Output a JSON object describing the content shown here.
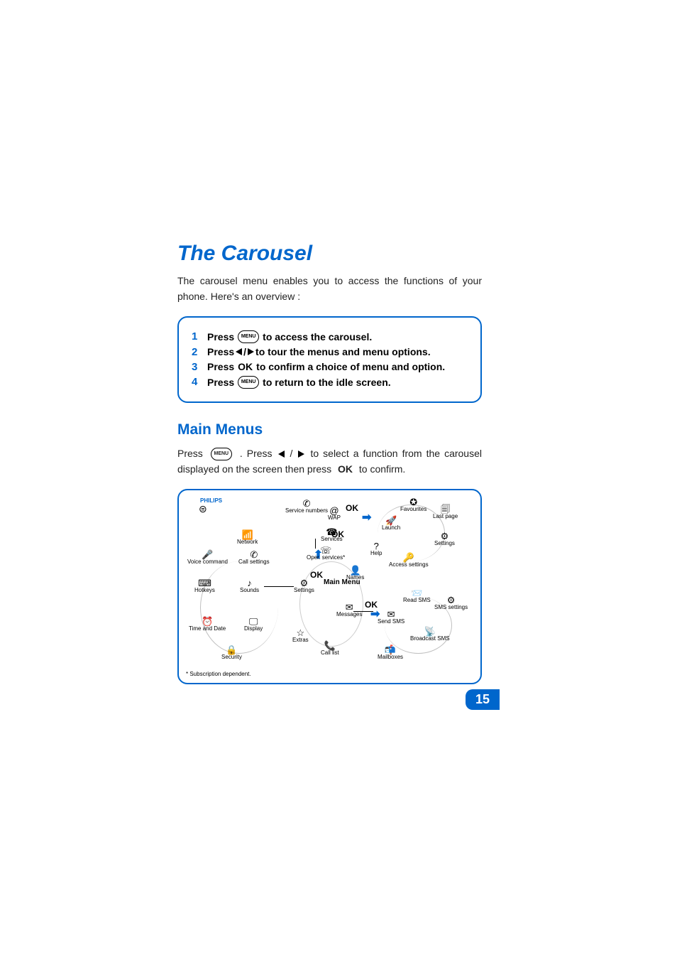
{
  "title": "The Carousel",
  "intro": "The carousel menu enables you to access the functions of your phone. Here's an overview :",
  "steps": [
    {
      "num": "1",
      "pre": "Press ",
      "icon": "menu",
      "post": " to access the carousel."
    },
    {
      "num": "2",
      "pre": "Press ",
      "icon": "leftright",
      "post": " to tour the menus and menu options."
    },
    {
      "num": "3",
      "pre": "Press ",
      "icon": "ok",
      "post": " to confirm a choice of menu and option."
    },
    {
      "num": "4",
      "pre": "Press ",
      "icon": "menu",
      "post": " to return to the idle screen."
    }
  ],
  "section_heading": "Main Menus",
  "body_pre": "Press ",
  "body_mid1": " . Press ",
  "body_mid2": " / ",
  "body_mid3": " to select a function from the carousel displayed on the screen then press ",
  "body_post": " to confirm.",
  "ok_text": "OK",
  "menu_label": "MENU",
  "philips": "PHILIPS",
  "diagram": {
    "main_menu": "Main\nMenu",
    "footnote": "* Subscription dependent.",
    "ok_labels": [
      "OK",
      "OK",
      "OK",
      "OK"
    ],
    "nodes": {
      "service_numbers": "Service numbers",
      "wap": "WAP",
      "services": "Services",
      "oper_services": "Oper. services*",
      "names": "Names",
      "messages": "Messages",
      "call_list": "Call list",
      "extras": "Extras",
      "settings": "Settings",
      "network": "Network",
      "voice_command": "Voice command",
      "call_settings": "Call settings",
      "hotkeys": "Hotkeys",
      "sounds": "Sounds",
      "time_date": "Time and Date",
      "display": "Display",
      "security": "Security",
      "favourites": "Favourites",
      "last_page": "Last page",
      "launch": "Launch",
      "help": "Help",
      "wap_settings": "Settings",
      "access_settings": "Access settings",
      "read_sms": "Read SMS",
      "sms_settings": "SMS settings",
      "send_sms": "Send SMS",
      "broadcast_sms": "Broadcast SMS",
      "mailboxes": "Mailboxes"
    }
  },
  "page_number": "15"
}
